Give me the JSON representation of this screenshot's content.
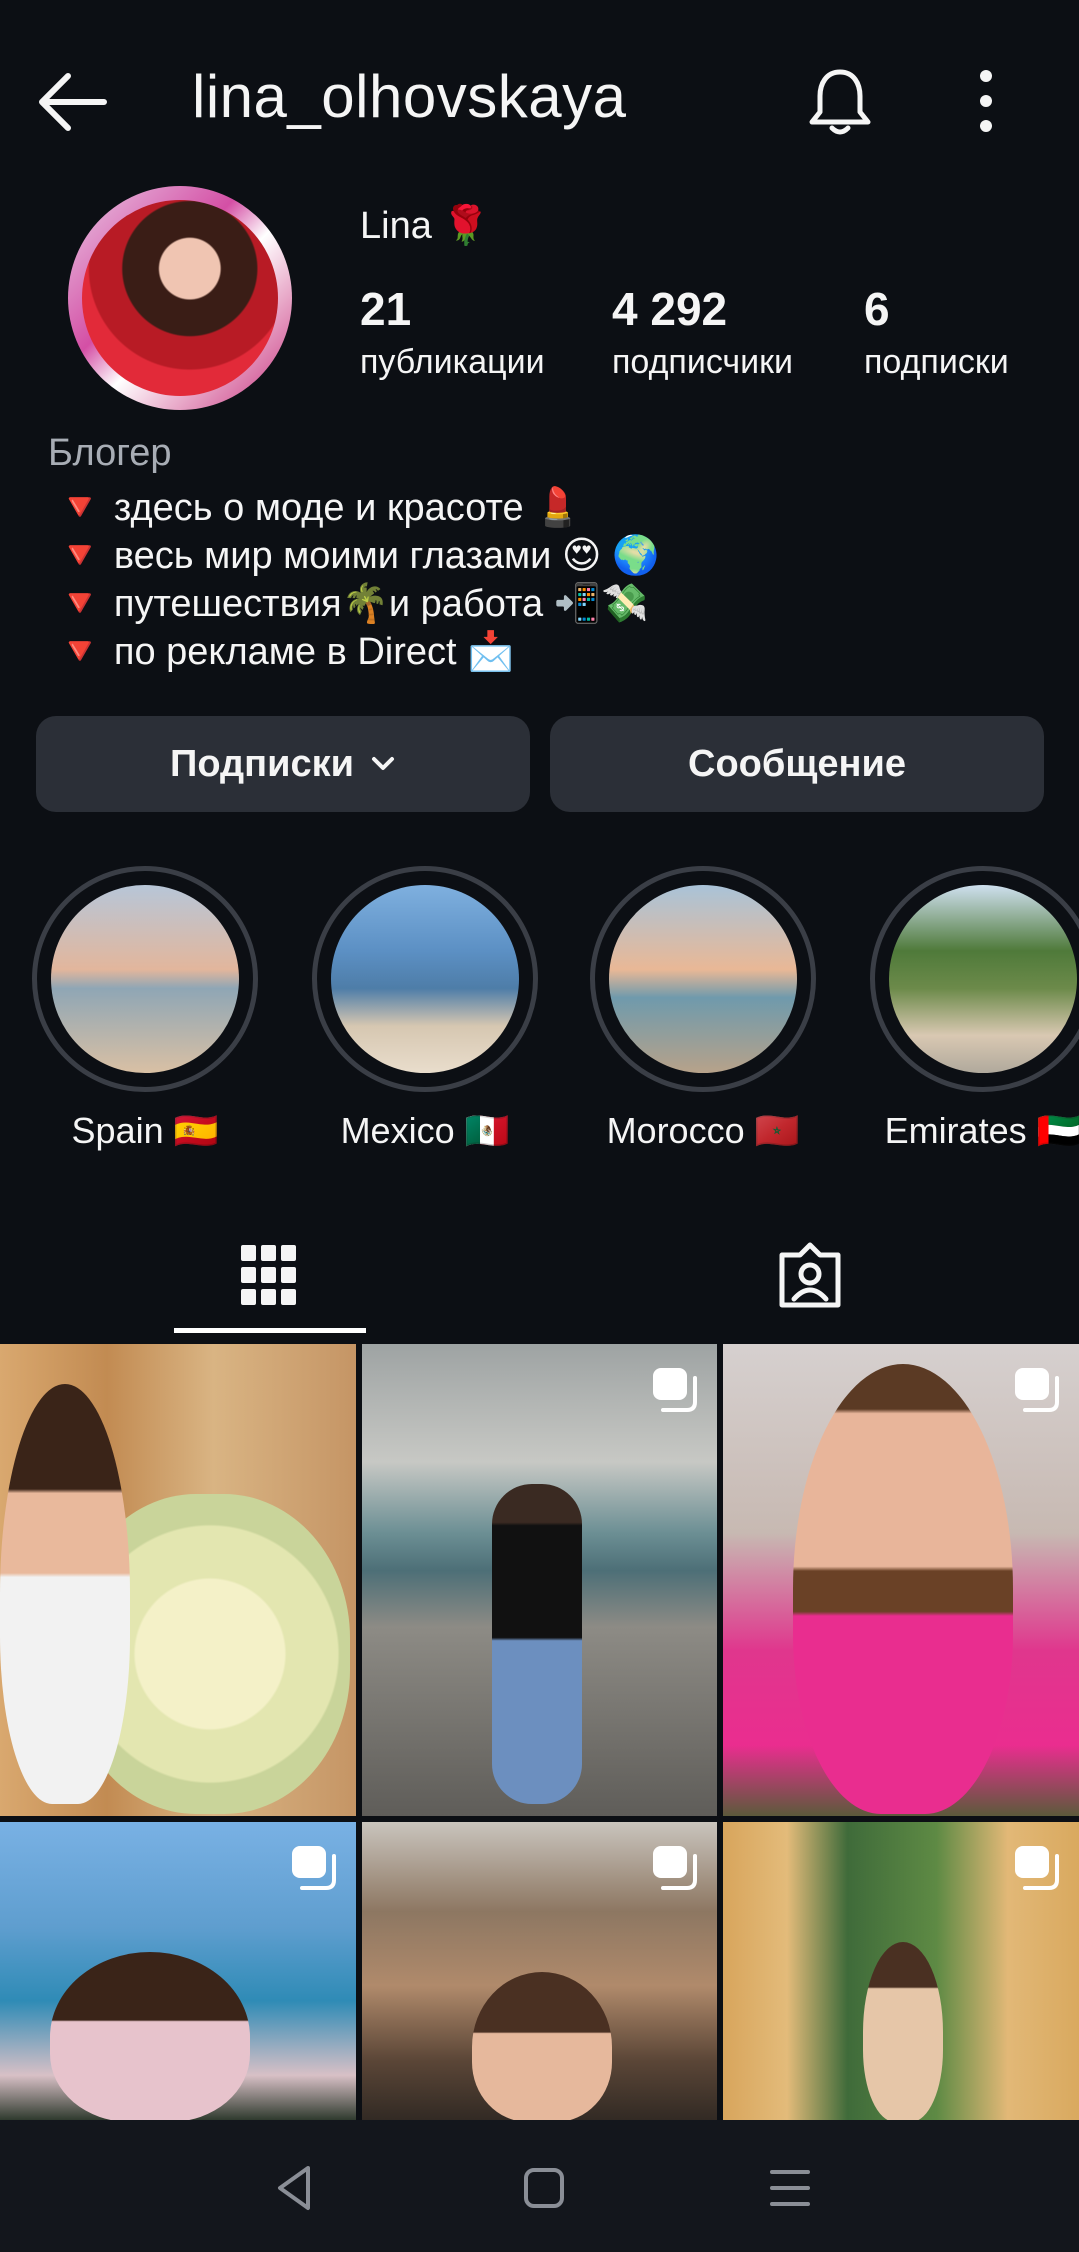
{
  "header": {
    "username": "lina_olhovskaya"
  },
  "profile": {
    "display_name": "Lina 🌹",
    "stats": [
      {
        "value": "21",
        "label": "публикации"
      },
      {
        "value": "4 292",
        "label": "подписчики"
      },
      {
        "value": "6",
        "label": "подписки"
      }
    ],
    "category": "Блогер",
    "bio": [
      "🔻 здесь о моде и красоте 💄",
      "🔻 весь мир моими глазами 😍 🌍",
      "🔻 путешествия🌴и работа 📲💸",
      "🔻 по рекламе в Direct 📩"
    ]
  },
  "actions": {
    "following_label": "Подписки",
    "message_label": "Сообщение"
  },
  "highlights": [
    {
      "label": "Spain 🇪🇸"
    },
    {
      "label": "Mexico 🇲🇽"
    },
    {
      "label": "Morocco 🇲🇦"
    },
    {
      "label": "Emirates 🇦🇪"
    }
  ],
  "tabs": {
    "active": "grid-icon",
    "items": [
      "grid-icon",
      "tagged-icon"
    ]
  },
  "posts": [
    {
      "multi": false
    },
    {
      "multi": true
    },
    {
      "multi": true
    },
    {
      "multi": true
    },
    {
      "multi": true
    },
    {
      "multi": true
    }
  ],
  "icons": {
    "back": "arrow-left-icon",
    "bell": "bell-icon",
    "more": "more-vertical-icon",
    "nav": [
      "back-triangle-icon",
      "home-square-icon",
      "menu-lines-icon"
    ]
  },
  "colors": {
    "background": "#0c0f14",
    "button": "#2b2f37",
    "secondary_text": "#a8adb5"
  }
}
